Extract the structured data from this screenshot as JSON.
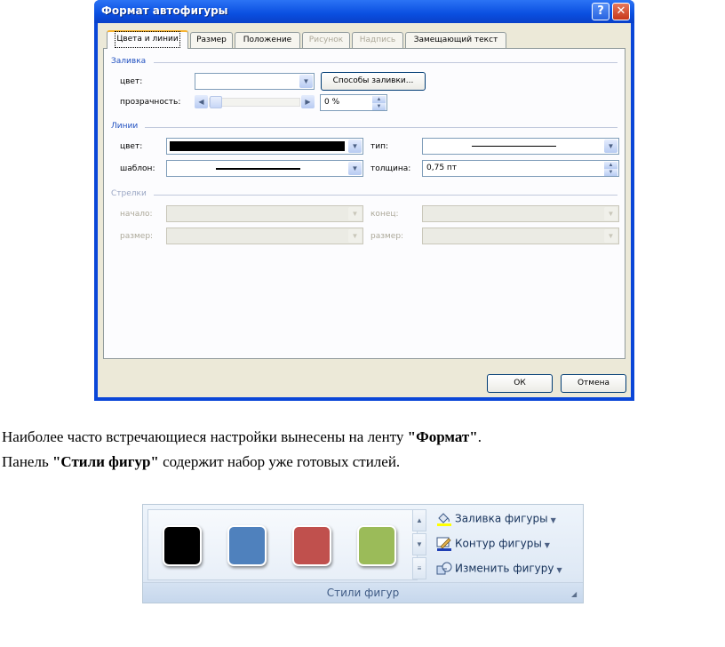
{
  "dialog": {
    "title": "Формат автофигуры",
    "help_label": "?",
    "close_label": "✕",
    "tabs": [
      {
        "label": "Цвета и линии",
        "state": "active"
      },
      {
        "label": "Размер",
        "state": "normal"
      },
      {
        "label": "Положение",
        "state": "normal"
      },
      {
        "label": "Рисунок",
        "state": "disabled"
      },
      {
        "label": "Надпись",
        "state": "disabled"
      },
      {
        "label": "Замещающий текст",
        "state": "normal"
      }
    ],
    "fill": {
      "section": "Заливка",
      "color_label": "цвет:",
      "fill_methods_button": "Способы заливки...",
      "transparency_label": "прозрачность:",
      "transparency_value": "0 %",
      "transparency_level": 0
    },
    "lines": {
      "section": "Линии",
      "color_label": "цвет:",
      "line_color": "#000000",
      "type_label": "тип:",
      "pattern_label": "шаблон:",
      "weight_label": "толщина:",
      "weight_value": "0,75 пт"
    },
    "arrows": {
      "section": "Стрелки",
      "begin_label": "начало:",
      "end_label": "конец:",
      "size1_label": "размер:",
      "size2_label": "размер:"
    },
    "ok_button": "ОК",
    "cancel_button": "Отмена"
  },
  "text": {
    "line1_a": "Наиболее часто встречающиеся настройки вынесены на ленту ",
    "line1_b": "\"Формат\"",
    "line1_c": ".",
    "line2_a": "Панель ",
    "line2_b": "\"Стили фигур\"",
    "line2_c": " содержит набор уже готовых стилей."
  },
  "ribbon": {
    "group_label": "Стили фигур",
    "styles": [
      {
        "color": "#000000"
      },
      {
        "color": "#4f81bd"
      },
      {
        "color": "#c0504d"
      },
      {
        "color": "#9bbb59"
      }
    ],
    "commands": [
      {
        "label": "Заливка фигуры",
        "icon": "paint-bucket-icon"
      },
      {
        "label": "Контур фигуры",
        "icon": "pencil-outline-icon"
      },
      {
        "label": "Изменить фигуру",
        "icon": "change-shape-icon"
      }
    ]
  }
}
